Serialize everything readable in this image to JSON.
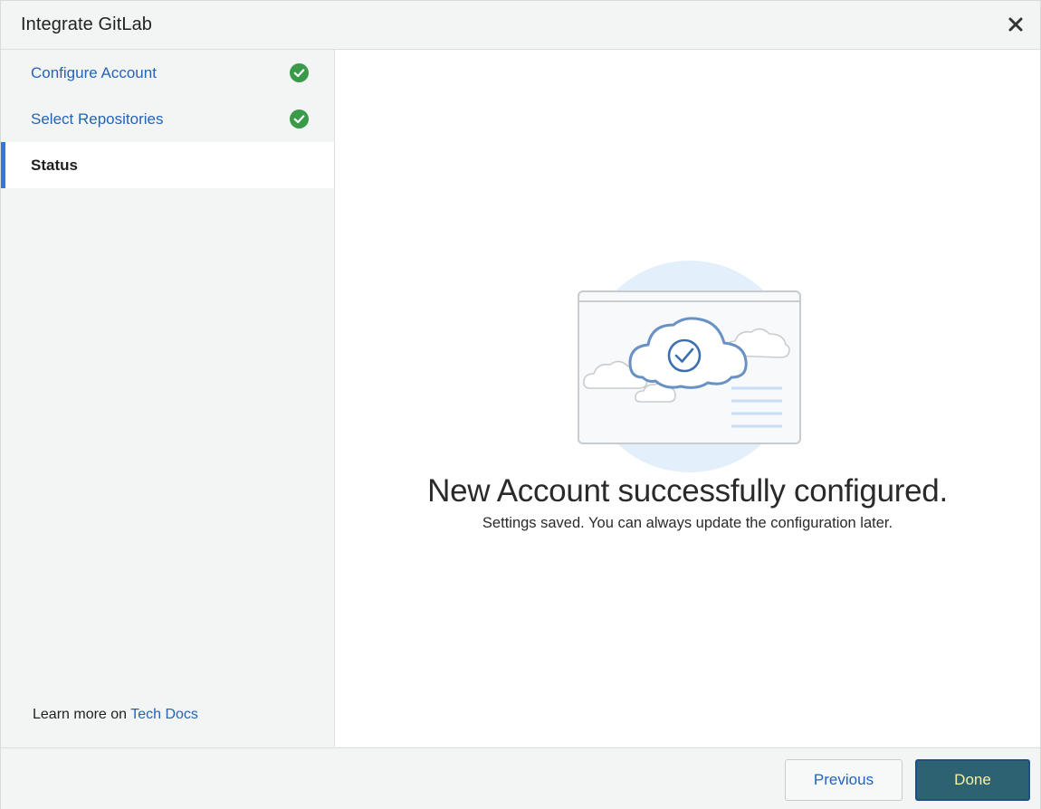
{
  "dialog": {
    "title": "Integrate GitLab",
    "close_icon": "close-icon"
  },
  "sidebar": {
    "steps": [
      {
        "label": "Configure Account",
        "state": "complete",
        "icon": "check-circle-icon"
      },
      {
        "label": "Select Repositories",
        "state": "complete",
        "icon": "check-circle-icon"
      },
      {
        "label": "Status",
        "state": "active"
      }
    ],
    "learn_more_prefix": "Learn more on",
    "learn_more_link": "Tech Docs"
  },
  "main": {
    "illustration": "cloud-success-illustration",
    "title": "New Account successfully configured.",
    "subtitle": "Settings saved. You can always update the configuration later."
  },
  "footer": {
    "previous_label": "Previous",
    "done_label": "Done"
  },
  "colors": {
    "accent": "#2f7ad6",
    "link": "#2563b8",
    "success": "#3a9a4a",
    "done_button": "#2c6272",
    "done_text": "#f6f2a8"
  }
}
